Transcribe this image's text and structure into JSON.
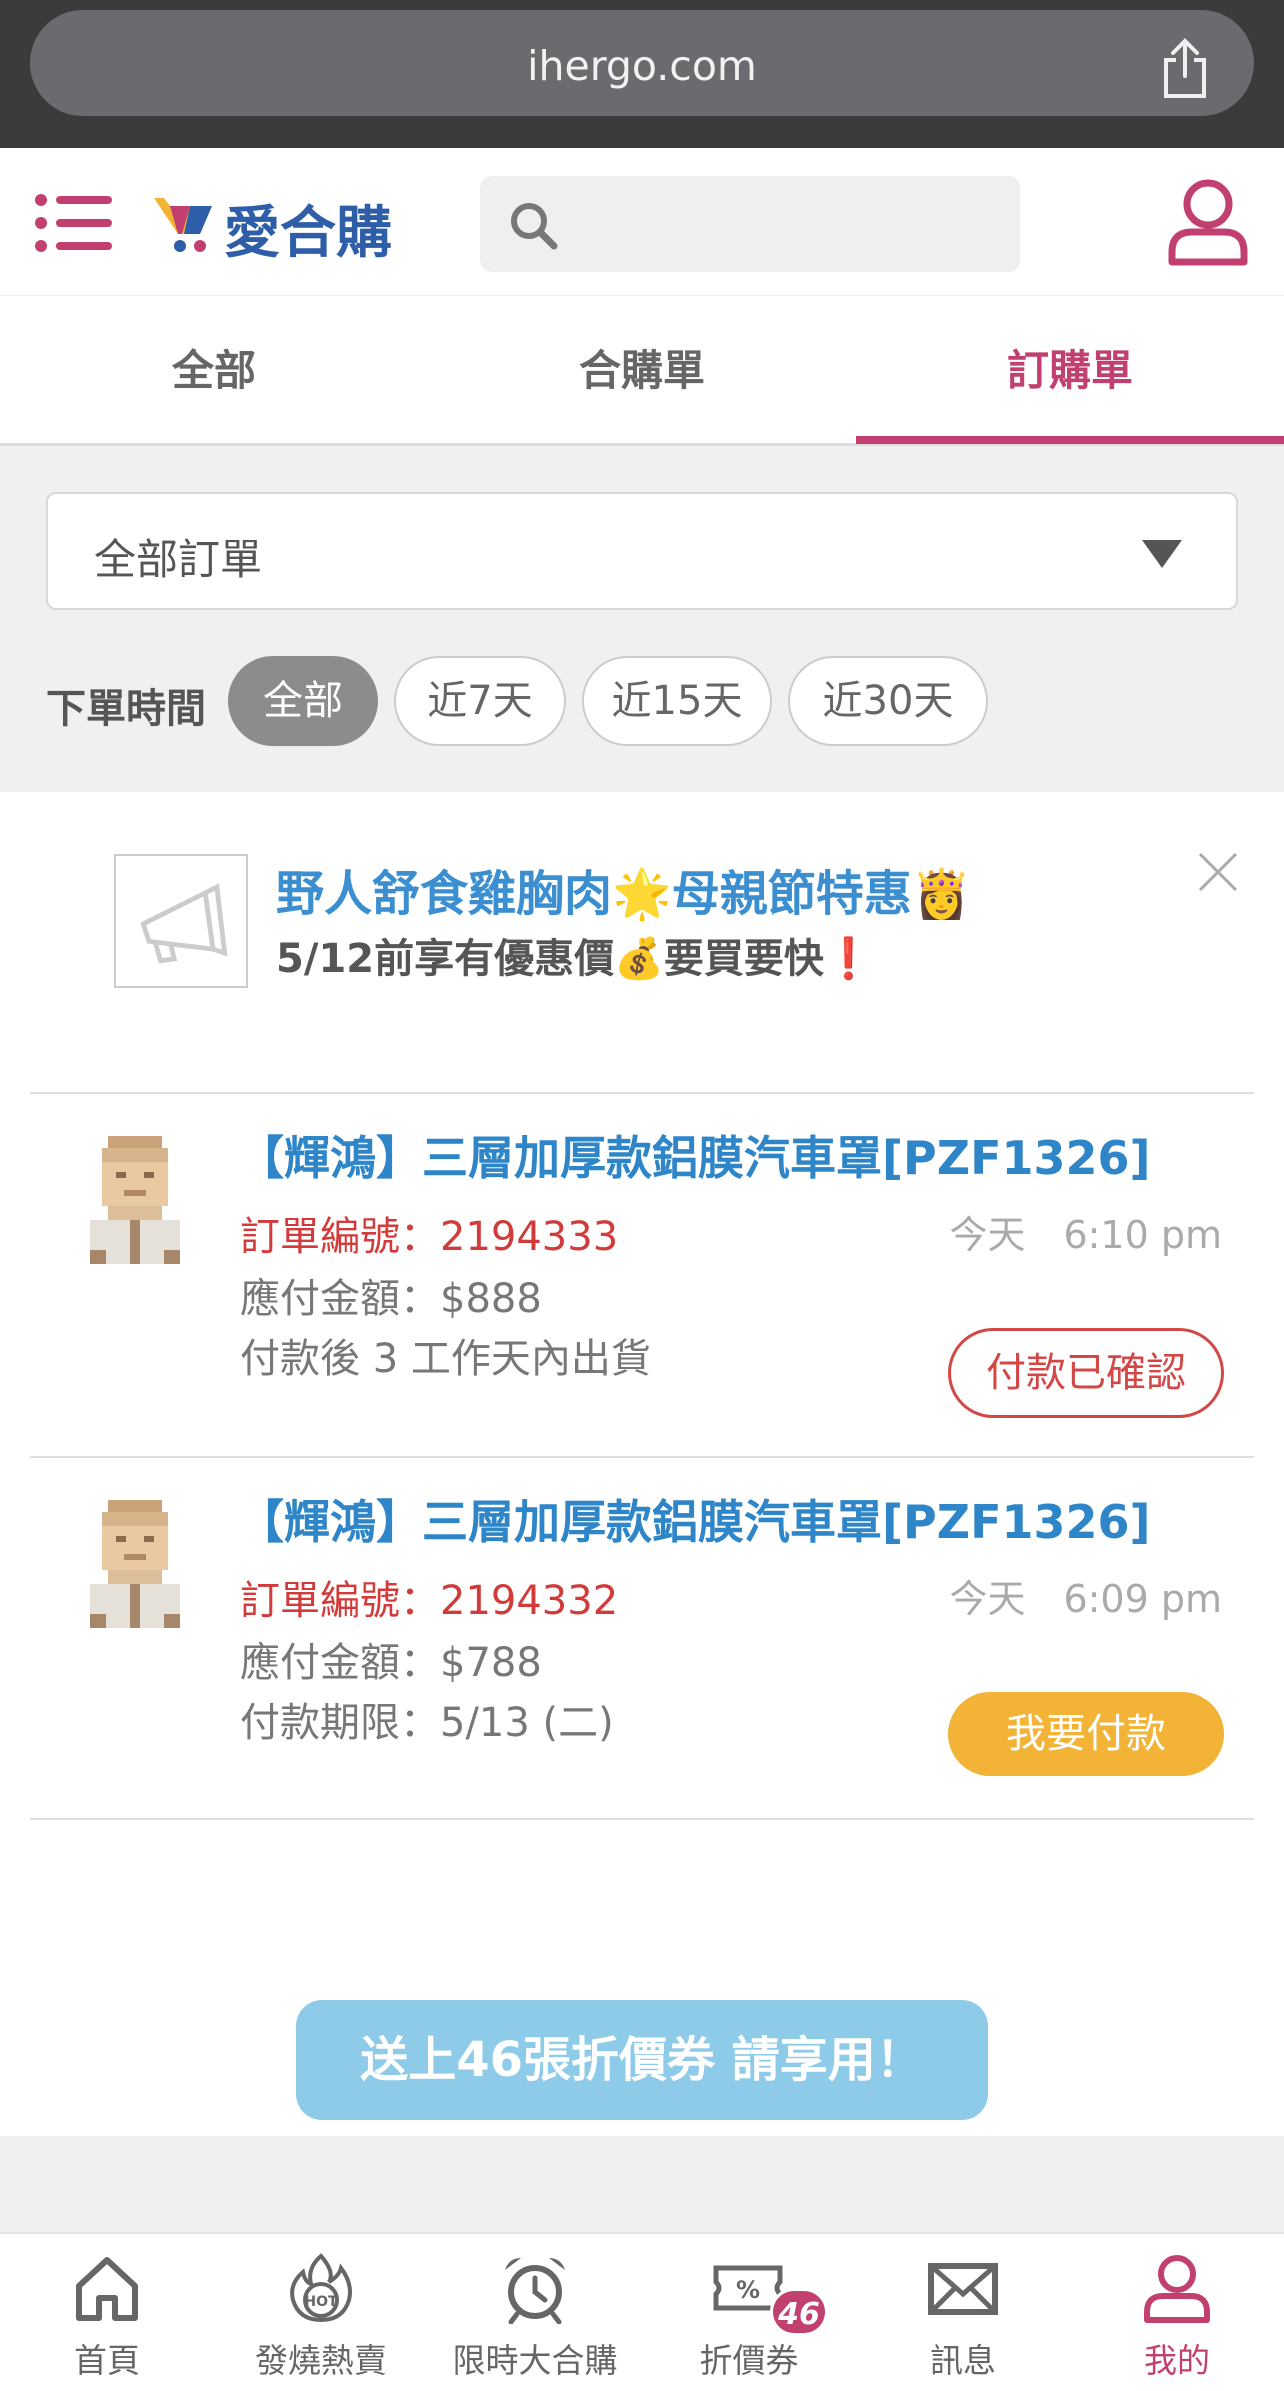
{
  "browser": {
    "url": "ihergo.com"
  },
  "header": {
    "logo_text": "愛合購",
    "search_placeholder": ""
  },
  "tabs": [
    {
      "label": "全部"
    },
    {
      "label": "合購單"
    },
    {
      "label": "訂購單",
      "active": true
    }
  ],
  "filter": {
    "select_value": "全部訂單",
    "time_label": "下單時間",
    "chips": [
      "全部",
      "近7天",
      "近15天",
      "近30天"
    ],
    "active_chip": "全部"
  },
  "announcement": {
    "title": "野人舒食雞胸肉🌟母親節特惠👸",
    "subtitle": "5/12前享有優惠價💰要買要快❗"
  },
  "orders": [
    {
      "title": "【輝鴻】三層加厚款鋁膜汽車罩[PZF1326]",
      "order_no": "訂單編號：2194333",
      "time": "今天　6:10 pm",
      "amount": "應付金額：$888",
      "note": "付款後 3 工作天內出貨",
      "action": "付款已確認"
    },
    {
      "title": "【輝鴻】三層加厚款鋁膜汽車罩[PZF1326]",
      "order_no": "訂單編號：2194332",
      "time": "今天　6:09 pm",
      "amount": "應付金額：$788",
      "note": "付款期限：5/13 (二)",
      "action": "我要付款"
    }
  ],
  "coupon_banner": "送上46張折價券 請享用！",
  "bottom_nav": [
    {
      "label": "首頁",
      "icon": "home-icon"
    },
    {
      "label": "發燒熱賣",
      "icon": "hot-icon"
    },
    {
      "label": "限時大合購",
      "icon": "alarm-clock-icon"
    },
    {
      "label": "折價券",
      "icon": "coupon-icon",
      "badge": "46"
    },
    {
      "label": "訊息",
      "icon": "mail-icon"
    },
    {
      "label": "我的",
      "icon": "user-icon",
      "active": true
    }
  ],
  "colors": {
    "brand": "#c2406f",
    "link_blue": "#2e86c8",
    "order_red": "#d33b3b",
    "pay_yellow": "#f2b336",
    "banner_blue": "#8dcbe9"
  }
}
